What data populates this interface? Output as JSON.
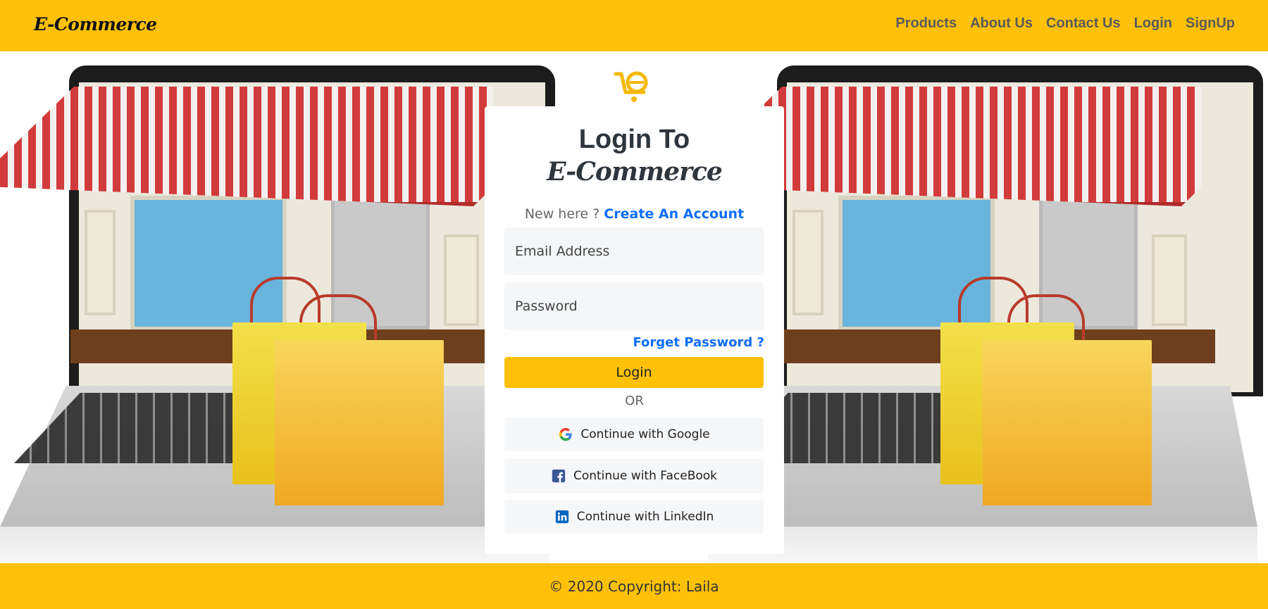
{
  "header": {
    "brand": "E-Commerce",
    "nav": [
      "Products",
      "About Us",
      "Contact Us",
      "Login",
      "SignUp"
    ]
  },
  "login": {
    "title_line1": "Login To",
    "title_line2": "E-Commerce",
    "new_here": "New here ? ",
    "create_account": "Create An Account",
    "email_placeholder": "Email Address",
    "password_placeholder": "Password",
    "forget": "Forget Password ?",
    "login_button": "Login",
    "or": "OR",
    "google": "Continue with Google",
    "facebook": "Continue with FaceBook",
    "linkedin": "Continue with LinkedIn"
  },
  "footer": {
    "copyright": "© 2020 Copyright: Laila"
  },
  "colors": {
    "accent": "#ffc107",
    "link": "#0d6efd",
    "facebook": "#3b5998",
    "linkedin": "#0a66c2"
  },
  "icons": {
    "logo": "cart-e-logo-icon",
    "google": "google-icon",
    "facebook": "facebook-icon",
    "linkedin": "linkedin-icon"
  }
}
